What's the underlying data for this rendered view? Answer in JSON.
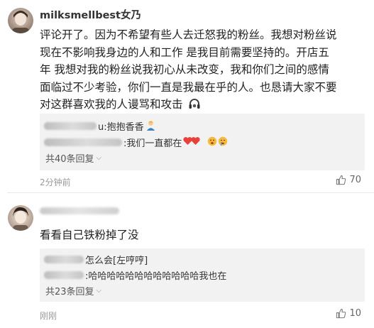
{
  "comments": [
    {
      "username": "milksmellbest女乃",
      "text_lines": [
        "评论开了。因为不希望有些人去迁怒我的粉丝。我想对粉丝说",
        "现在不影响我身边的人和工作 是我目前需要坚持的。开店五",
        "年 我想对我的粉丝说我初心从未改变，我和你们之间的感情",
        "面临过不少考验，你们一直是我最在乎的人。也恳请大家不要",
        "对这群喜欢我的人谩骂和攻击"
      ],
      "replies": [
        "u:抱抱香香",
        ":我们一直都在"
      ],
      "more_replies": "共40条回复",
      "time": "2分钟前",
      "likes": "70"
    },
    {
      "username": "",
      "text_lines": [
        "看看自己铁粉掉了没"
      ],
      "replies": [
        "怎么会[左哼哼]",
        ":哈哈哈哈哈哈哈哈哈哈哈哈我也在"
      ],
      "more_replies": "共23条回复",
      "time": "刚刚",
      "likes": "10"
    }
  ],
  "icons": {
    "like": "thumbs-up-icon",
    "chevron": "chevron-down-icon",
    "headphones": "headphones-emoji-icon",
    "hearts": "heart-emoji-icon",
    "crying": "crying-face-emoji-icon",
    "folded-hands": "person-emoji-icon"
  },
  "colors": {
    "heart": "#e8413a",
    "emoji_face": "#f6b93b",
    "reply_bg": "#f2f2f2",
    "meta_gray": "#999999"
  }
}
